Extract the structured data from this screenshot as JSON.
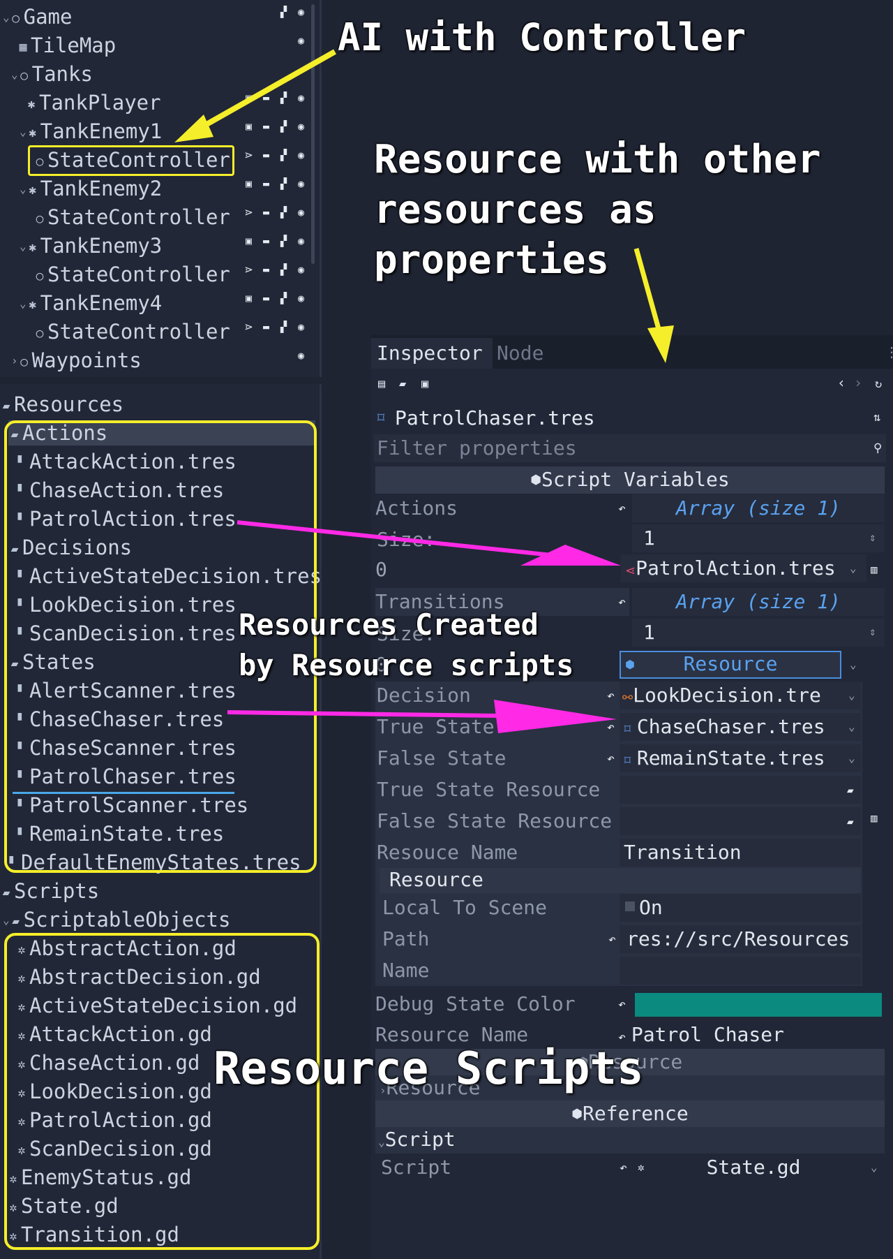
{
  "scene_tree": [
    {
      "label": "Game",
      "icon": "node-circle-icon",
      "arrow": "expanded"
    },
    {
      "label": "TileMap",
      "icon": "tilemap-icon"
    },
    {
      "label": "Tanks",
      "icon": "node-circle-icon",
      "arrow": "expanded"
    },
    {
      "label": "TankPlayer",
      "icon": "kinematic-body-icon"
    },
    {
      "label": "TankEnemy1",
      "icon": "kinematic-body-icon",
      "arrow": "expanded"
    },
    {
      "label": "StateController",
      "icon": "node-circle-icon"
    },
    {
      "label": "TankEnemy2",
      "icon": "kinematic-body-icon",
      "arrow": "expanded"
    },
    {
      "label": "StateController",
      "icon": "node-circle-icon"
    },
    {
      "label": "TankEnemy3",
      "icon": "kinematic-body-icon",
      "arrow": "expanded"
    },
    {
      "label": "StateController",
      "icon": "node-circle-icon"
    },
    {
      "label": "TankEnemy4",
      "icon": "kinematic-body-icon",
      "arrow": "expanded"
    },
    {
      "label": "StateController",
      "icon": "node-circle-icon"
    },
    {
      "label": "Waypoints",
      "icon": "node-circle-icon",
      "arrow": "collapsed"
    }
  ],
  "filesystem": {
    "root": "Resources",
    "groups": [
      {
        "folder": "Actions",
        "files": [
          "AttackAction.tres",
          "ChaseAction.tres",
          "PatrolAction.tres"
        ]
      },
      {
        "folder": "Decisions",
        "files": [
          "ActiveStateDecision.tres",
          "LookDecision.tres",
          "ScanDecision.tres"
        ]
      },
      {
        "folder": "States",
        "files": [
          "AlertScanner.tres",
          "ChaseChaser.tres",
          "ChaseScanner.tres",
          "PatrolChaser.tres",
          "PatrolScanner.tres",
          "RemainState.tres"
        ]
      }
    ],
    "loose_file": "DefaultEnemyStates.tres",
    "scripts_folder": "Scripts",
    "so_folder": "ScriptableObjects",
    "so_files": [
      "AbstractAction.gd",
      "AbstractDecision.gd",
      "ActiveStateDecision.gd",
      "AttackAction.gd",
      "ChaseAction.gd",
      "LookDecision.gd",
      "PatrolAction.gd",
      "ScanDecision.gd"
    ],
    "script_files": [
      "EnemyStatus.gd",
      "State.gd",
      "Transition.gd"
    ]
  },
  "inspector": {
    "tabs": [
      "Inspector",
      "Node"
    ],
    "resource_path": "PatrolChaser.tres",
    "filter_placeholder": "Filter properties",
    "script_variables_header": "Script Variables",
    "actions_label": "Actions",
    "actions_value": "Array (size 1)",
    "size_label": "Size:",
    "actions_size": "1",
    "index0": "0",
    "actions_item": "PatrolAction.tres",
    "transitions_label": "Transitions",
    "transitions_value": "Array (size 1)",
    "transitions_size": "1",
    "resource_button": "Resource",
    "decision_label": "Decision",
    "decision_value": "LookDecision.tre",
    "true_state_label": "True State",
    "true_state_value": "ChaseChaser.tres",
    "false_state_label": "False State",
    "false_state_value": "RemainState.tres",
    "true_state_resource_label": "True State Resource",
    "false_state_resource_label": "False State Resource",
    "resouce_name_label": "Resouce Name",
    "resouce_name_value": "Transition",
    "resource_subheader": "Resource",
    "local_to_scene_label": "Local To Scene",
    "local_to_scene_value": "On",
    "path_label": "Path",
    "path_value": "res://src/Resources",
    "name_label": "Name",
    "debug_state_color_label": "Debug State Color",
    "debug_state_color": "#0b8a80",
    "resource_name_label": "Resource Name",
    "resource_name_value": "Patrol Chaser",
    "resource_section_header": "Resource",
    "resource_collapsed": "Resource",
    "reference_header": "Reference",
    "script_group": "Script",
    "script_label": "Script",
    "script_value": "State.gd"
  },
  "annotations": {
    "ai_controller": "AI with Controller",
    "resource_props_1": "Resource with other",
    "resource_props_2": "resources as",
    "resource_props_3": "properties",
    "created_1": "Resources Created",
    "created_2": "by Resource scripts",
    "scripts": "Resource Scripts"
  },
  "colors": {
    "annotation_arrow": "#f5ee2a",
    "link_arrow": "#ff29e6",
    "highlight_box": "#f5ee2a",
    "accent": "#4aa8e8"
  }
}
